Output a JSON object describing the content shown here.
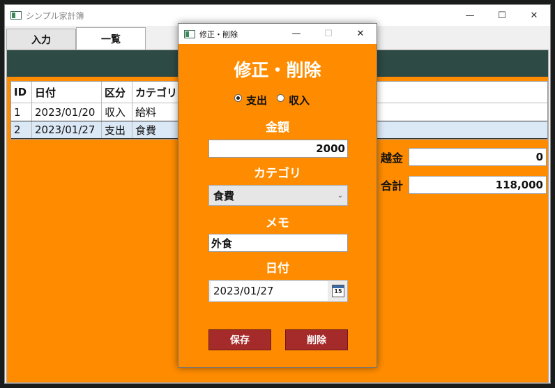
{
  "app": {
    "title": "シンプル家計簿",
    "controls": {
      "minimize": "—",
      "maximize": "☐",
      "close": "✕"
    }
  },
  "tabs": [
    {
      "label": "入力",
      "active": false
    },
    {
      "label": "一覧",
      "active": true
    }
  ],
  "grid": {
    "headers": [
      "ID",
      "日付",
      "区分",
      "カテゴリ"
    ],
    "rows": [
      [
        "1",
        "2023/01/20",
        "収入",
        "給料"
      ],
      [
        "2",
        "2023/01/27",
        "支出",
        "食費"
      ]
    ]
  },
  "summary": {
    "carryover_label": "越金",
    "carryover_value": "0",
    "total_label": "合計",
    "total_value": "118,000"
  },
  "dialog": {
    "title": "修正・削除",
    "heading": "修正・削除",
    "radio_expense": "支出",
    "radio_income": "収入",
    "selected": "支出",
    "amount_label": "金額",
    "amount_value": "2000",
    "category_label": "カテゴリ",
    "category_value": "食費",
    "memo_label": "メモ",
    "memo_value": "外食",
    "date_label": "日付",
    "date_value": "2023/01/27",
    "calendar_day": "15",
    "save_button": "保存",
    "delete_button": "削除"
  },
  "colors": {
    "accent": "#ff8c00",
    "header_band": "#2e4a44",
    "button": "#a52a2a"
  },
  "icons": [
    "app-icon",
    "calendar-icon",
    "chevron-down-icon",
    "minimize-icon",
    "maximize-icon",
    "close-icon"
  ]
}
